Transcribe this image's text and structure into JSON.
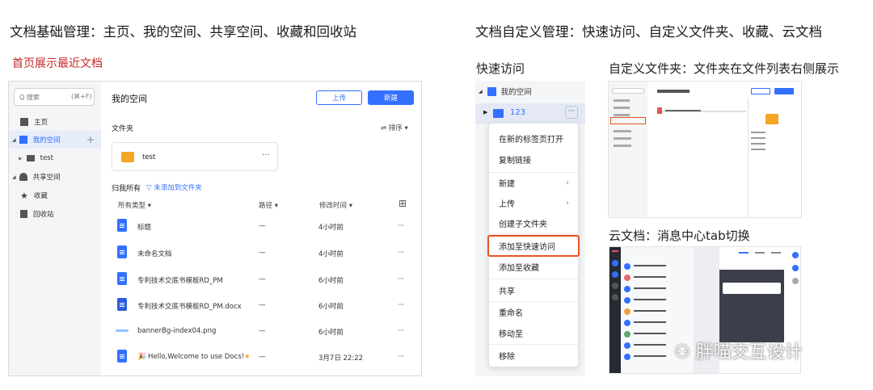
{
  "headings": {
    "left": "文档基础管理：主页、我的空间、共享空间、收藏和回收站",
    "right": "文档自定义管理：快速访问、自定义文件夹、收藏、云文档",
    "recent_note": "首页展示最近文档",
    "quick_access": "快速访问",
    "custom_folder": "自定义文件夹：文件夹在文件列表右侧展示",
    "cloud_doc": "云文档：消息中心tab切换",
    "watermark": "胖喵交互设计"
  },
  "app": {
    "search_placeholder": "Q 搜索",
    "search_shortcut": "(⌘+F)",
    "sidebar": [
      {
        "label": "主页"
      },
      {
        "label": "我的空间"
      },
      {
        "label": "test"
      },
      {
        "label": "共享空间"
      },
      {
        "label": "收藏"
      },
      {
        "label": "回收站"
      }
    ],
    "title": "我的空间",
    "upload": "上传",
    "new": "新建",
    "folders_heading": "文件夹",
    "sort": "排序",
    "folder_name": "test",
    "owner_heading": "归我所有",
    "filter_label": "未添加到文件夹",
    "columns": {
      "type": "所有类型",
      "path": "路径",
      "modified": "修改时间"
    },
    "rows": [
      {
        "name": "标题",
        "path": "—",
        "time": "4小时前"
      },
      {
        "name": "未命名文档",
        "path": "—",
        "time": "4小时前"
      },
      {
        "name": "专利技术交底书模板RD_PM",
        "path": "—",
        "time": "6小时前"
      },
      {
        "name": "专利技术交底书模板RD_PM.docx",
        "path": "—",
        "time": "6小时前"
      },
      {
        "name": "bannerBg-index04.png",
        "path": "—",
        "time": "6小时前"
      },
      {
        "name": "Hello,Welcome to use Docs!",
        "path": "—",
        "time": "3月7日 22:22"
      }
    ],
    "more": "···"
  },
  "context": {
    "tree_root": "我的空间",
    "tree_folder": "123",
    "menu": [
      {
        "label": "在新的标签页打开"
      },
      {
        "label": "复制链接"
      },
      {
        "label": "新建"
      },
      {
        "label": "上传"
      },
      {
        "label": "创建子文件夹"
      },
      {
        "label": "添加至快速访问"
      },
      {
        "label": "添加至收藏"
      },
      {
        "label": "共享"
      },
      {
        "label": "重命名"
      },
      {
        "label": "移动至"
      },
      {
        "label": "移除"
      }
    ]
  },
  "colors": {
    "accent": "#3370ff",
    "folder": "#f5a623",
    "highlight": "#e8541e",
    "red": "#c62828"
  }
}
